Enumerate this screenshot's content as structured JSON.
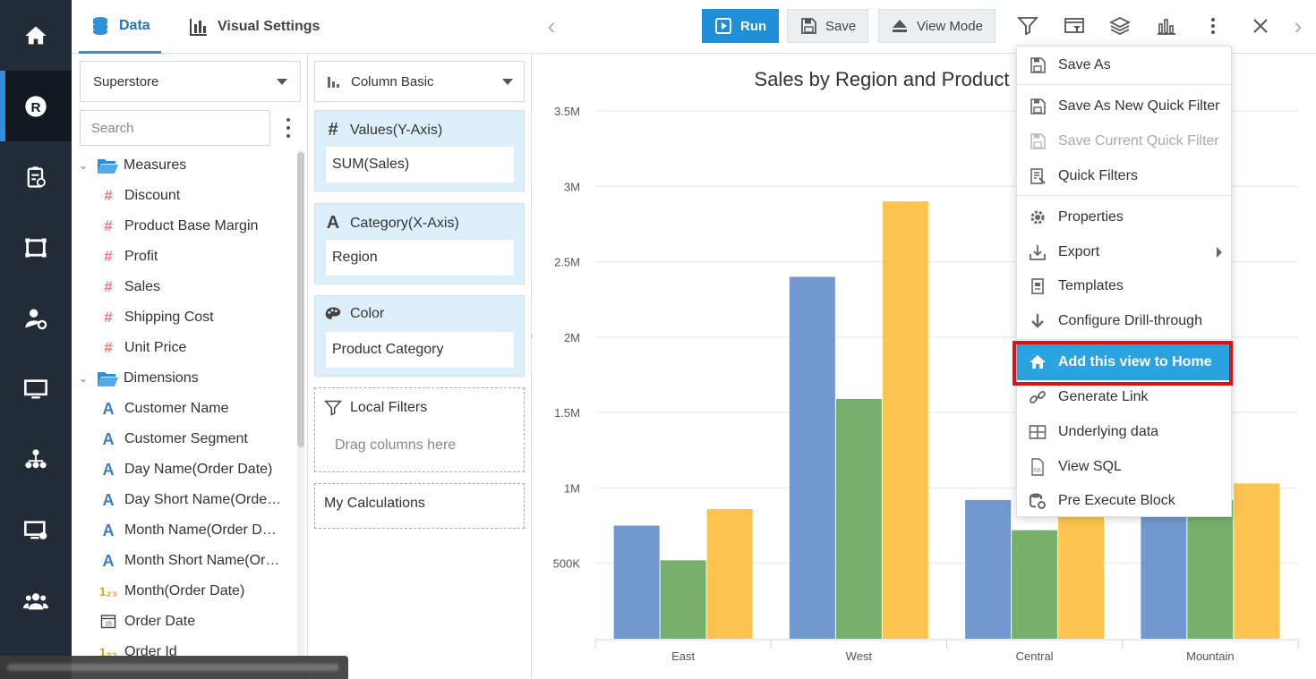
{
  "rail": {
    "items": [
      "home-icon",
      "reports-icon",
      "checklist-icon",
      "dashboard-icon",
      "user-settings-icon",
      "monitor-icon",
      "org-chart-icon",
      "remote-desktop-icon",
      "users-icon"
    ],
    "active_index": 1,
    "active_letter": "R"
  },
  "tabs": {
    "data": "Data",
    "visual_settings": "Visual Settings"
  },
  "datasource": {
    "selected": "Superstore"
  },
  "search": {
    "placeholder": "Search"
  },
  "tree": {
    "measures_label": "Measures",
    "measures": [
      "Discount",
      "Product Base Margin",
      "Profit",
      "Sales",
      "Shipping Cost",
      "Unit Price"
    ],
    "dimensions_label": "Dimensions",
    "dimensions": [
      {
        "label": "Customer Name",
        "icon": "text"
      },
      {
        "label": "Customer Segment",
        "icon": "text"
      },
      {
        "label": "Day Name(Order Date)",
        "icon": "text"
      },
      {
        "label": "Day Short Name(Orde…",
        "icon": "text"
      },
      {
        "label": "Month Name(Order D…",
        "icon": "text"
      },
      {
        "label": "Month Short Name(Or…",
        "icon": "text"
      },
      {
        "label": "Month(Order Date)",
        "icon": "number"
      },
      {
        "label": "Order Date",
        "icon": "date"
      },
      {
        "label": "Order Id",
        "icon": "number"
      }
    ]
  },
  "shelves": {
    "chart_type": "Column Basic",
    "values_title": "Values(Y-Axis)",
    "values_pill": "SUM(Sales)",
    "category_title": "Category(X-Axis)",
    "category_pill": "Region",
    "color_title": "Color",
    "color_pill": "Product Category",
    "local_filters_title": "Local Filters",
    "local_filters_hint": "Drag columns here",
    "my_calculations": "My Calculations"
  },
  "toolbar": {
    "run": "Run",
    "save": "Save",
    "view_mode": "View Mode",
    "icons": [
      "filter-icon",
      "filter-panel-icon",
      "layers-icon",
      "chart-icon",
      "more-icon",
      "close-icon"
    ]
  },
  "menu": {
    "items": [
      {
        "label": "Save As",
        "icon": "save-as-icon",
        "state": "normal"
      },
      {
        "label": "Save As New Quick Filter",
        "icon": "save-filter-icon",
        "state": "normal"
      },
      {
        "label": "Save Current Quick Filter",
        "icon": "save-current-filter-icon",
        "state": "disabled"
      },
      {
        "label": "Quick Filters",
        "icon": "quick-filters-icon",
        "state": "normal"
      },
      {
        "label": "Properties",
        "icon": "gear-icon",
        "state": "normal"
      },
      {
        "label": "Export",
        "icon": "export-icon",
        "state": "submenu"
      },
      {
        "label": "Templates",
        "icon": "templates-icon",
        "state": "normal"
      },
      {
        "label": "Configure Drill-through",
        "icon": "arrow-down-icon",
        "state": "normal"
      },
      {
        "label": "Add this view to Home",
        "icon": "home-icon",
        "state": "highlighted"
      },
      {
        "label": "Generate Link",
        "icon": "link-icon",
        "state": "normal"
      },
      {
        "label": "Underlying data",
        "icon": "table-icon",
        "state": "normal"
      },
      {
        "label": "View SQL",
        "icon": "sql-file-icon",
        "state": "normal"
      },
      {
        "label": "Pre Execute Block",
        "icon": "database-gear-icon",
        "state": "normal"
      }
    ]
  },
  "colors": {
    "accent": "#2aa3e0",
    "run_button": "#1e8fd6",
    "highlight_border": "#e01010",
    "series": [
      "#7199cf",
      "#77b06a",
      "#fcc44e"
    ]
  },
  "chart_data": {
    "type": "bar",
    "title": "Sales by Region and Product",
    "categories": [
      "East",
      "West",
      "Central",
      "Mountain"
    ],
    "series": [
      {
        "values": [
          750000,
          2400000,
          920000,
          920000
        ]
      },
      {
        "values": [
          520000,
          1590000,
          720000,
          920000
        ]
      },
      {
        "values": [
          860000,
          2900000,
          920000,
          1030000
        ]
      }
    ],
    "ylim": [
      0,
      3500000
    ],
    "yticks": [
      "500K",
      "1M",
      "1.5M",
      "2M",
      "2.5M",
      "3M",
      "3.5M"
    ],
    "grid": true,
    "xlabel": "",
    "ylabel": ""
  }
}
